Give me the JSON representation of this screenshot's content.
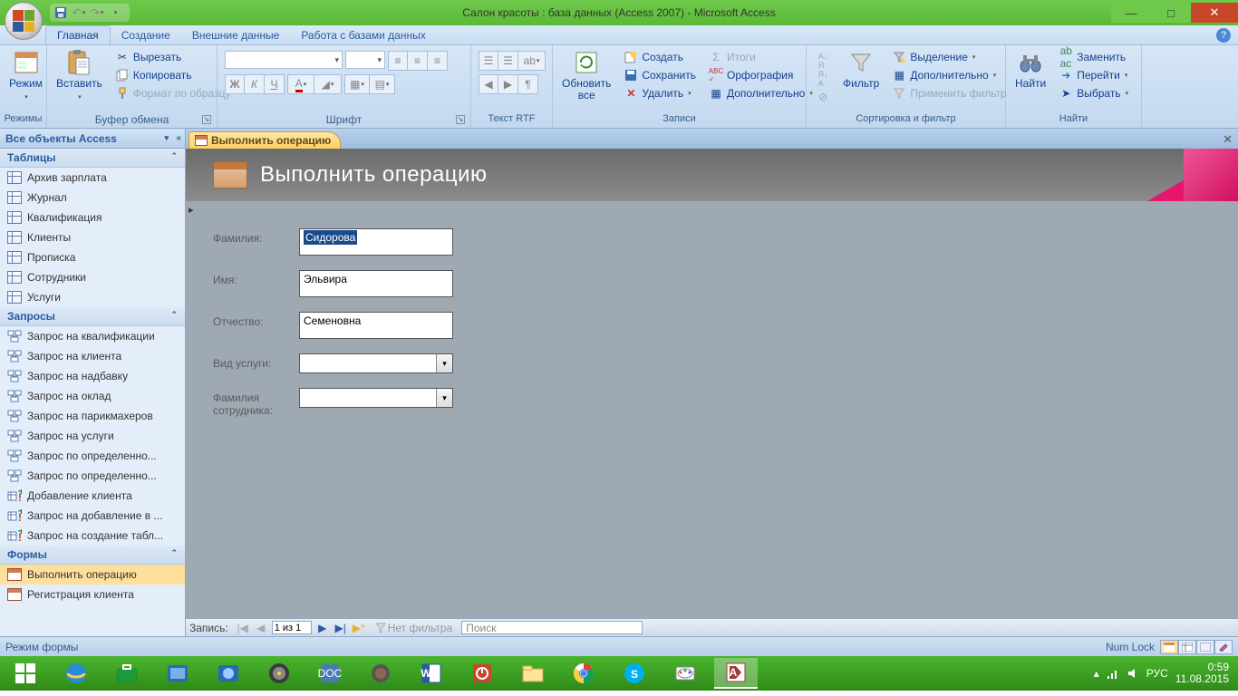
{
  "title": "Салон красоты : база данных (Access 2007) - Microsoft Access",
  "tabs": {
    "home": "Главная",
    "create": "Создание",
    "external": "Внешние данные",
    "dbtools": "Работа с базами данных"
  },
  "ribbon": {
    "modes": {
      "btn": "Режим",
      "label": "Режимы"
    },
    "clipboard": {
      "paste": "Вставить",
      "cut": "Вырезать",
      "copy": "Копировать",
      "format": "Формат по образцу",
      "label": "Буфер обмена"
    },
    "font": {
      "label": "Шрифт",
      "bold": "Ж",
      "italic": "К",
      "underline": "Ч"
    },
    "richtext": {
      "label": "Текст RTF"
    },
    "records": {
      "refresh": "Обновить\nвсе",
      "new": "Создать",
      "save": "Сохранить",
      "delete": "Удалить",
      "totals": "Итоги",
      "spelling": "Орфография",
      "more": "Дополнительно",
      "label": "Записи"
    },
    "sortfilter": {
      "filter": "Фильтр",
      "selection": "Выделение",
      "advanced": "Дополнительно",
      "toggle": "Применить фильтр",
      "label": "Сортировка и фильтр"
    },
    "find": {
      "find": "Найти",
      "replace": "Заменить",
      "goto": "Перейти",
      "select": "Выбрать",
      "label": "Найти"
    }
  },
  "nav": {
    "header": "Все объекты Access",
    "sections": {
      "tables": {
        "title": "Таблицы",
        "items": [
          "Архив зарплата",
          "Журнал",
          "Квалификация",
          "Клиенты",
          "Прописка",
          "Сотрудники",
          "Услуги"
        ]
      },
      "queries": {
        "title": "Запросы",
        "items": [
          "Запрос на квалификации",
          "Запрос на клиента",
          "Запрос на надбавку",
          "Запрос на оклад",
          "Запрос на парикмахеров",
          "Запрос на услуги",
          "Запрос по определенно...",
          "Запрос по определенно...",
          "Добавление клиента",
          "Запрос на добавление в ...",
          "Запрос на создание табл..."
        ]
      },
      "forms": {
        "title": "Формы",
        "items": [
          "Выполнить операцию",
          "Регистрация клиента"
        ]
      }
    }
  },
  "doc": {
    "tab": "Выполнить операцию",
    "title": "Выполнить операцию"
  },
  "form": {
    "f1": {
      "label": "Фамилия:",
      "value": "Сидорова"
    },
    "f2": {
      "label": "Имя:",
      "value": "Эльвира"
    },
    "f3": {
      "label": "Отчество:",
      "value": "Семеновна"
    },
    "f4": {
      "label": "Вид услуги:",
      "value": ""
    },
    "f5": {
      "label": "Фамилия сотрудника:",
      "value": ""
    }
  },
  "recnav": {
    "label": "Запись:",
    "pos": "1 из 1",
    "nofilter": "Нет фильтра",
    "search": "Поиск"
  },
  "status": {
    "mode": "Режим формы",
    "numlock": "Num Lock"
  },
  "tray": {
    "lang": "РУС",
    "time": "0:59",
    "date": "11.08.2015"
  }
}
